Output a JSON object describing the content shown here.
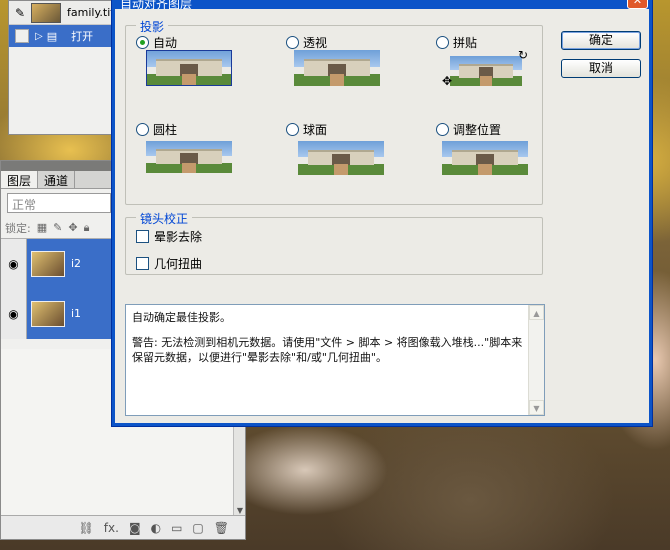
{
  "history": {
    "file_name": "family.tif",
    "state_label": "打开"
  },
  "layers": {
    "tab_layers": "图层",
    "tab_channels": "通道",
    "blend_mode": "正常",
    "lock_label": "锁定:",
    "items": [
      {
        "name": "i2"
      },
      {
        "name": "i1"
      }
    ],
    "toolbar_icons": [
      "link-icon",
      "fx-icon",
      "mask-icon",
      "adjustment-icon",
      "folder-icon",
      "new-layer-icon",
      "trash-icon"
    ],
    "fx_label": "fx."
  },
  "dialog": {
    "title": "自动对齐图层",
    "close_glyph": "✕",
    "projection": {
      "legend": "投影",
      "options": [
        {
          "label": "自动",
          "selected": true
        },
        {
          "label": "透视",
          "selected": false
        },
        {
          "label": "拼贴",
          "selected": false
        },
        {
          "label": "圆柱",
          "selected": false
        },
        {
          "label": "球面",
          "selected": false
        },
        {
          "label": "调整位置",
          "selected": false
        }
      ]
    },
    "lens": {
      "legend": "镜头校正",
      "vignette": "晕影去除",
      "distortion": "几何扭曲"
    },
    "ok_label": "确定",
    "cancel_label": "取消",
    "message": {
      "line1": "自动确定最佳投影。",
      "line2": "警告: 无法检测到相机元数据。请使用\"文件 > 脚本 > 将图像载入堆栈...\"脚本来保留元数据，以便进行\"晕影去除\"和/或\"几何扭曲\"。"
    }
  }
}
